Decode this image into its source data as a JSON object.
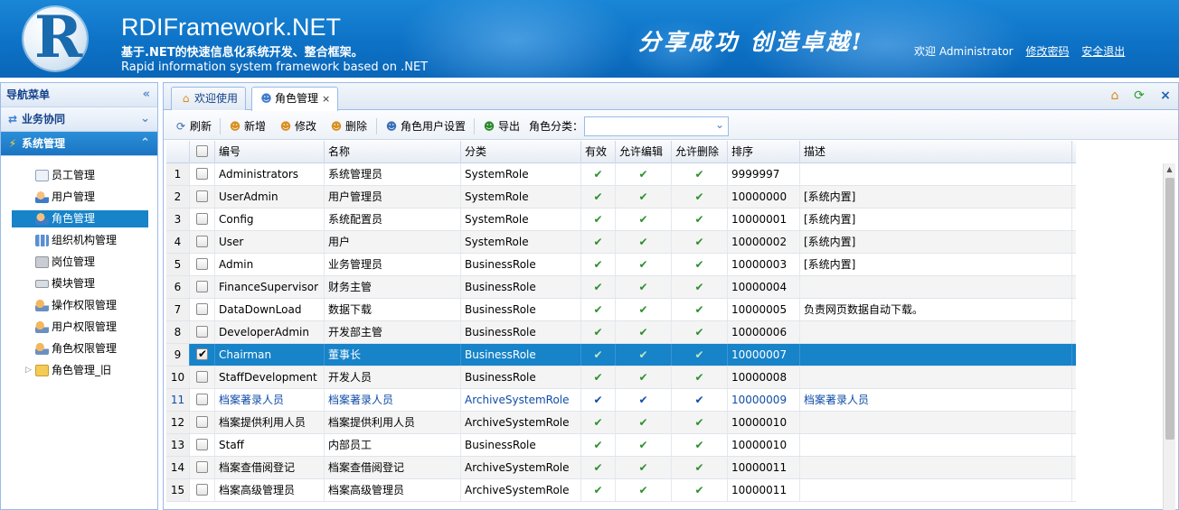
{
  "header": {
    "logo_letter": "R",
    "title": "RDIFramework.NET",
    "subtitle_cn": "基于.NET的快速信息化系统开发、整合框架。",
    "subtitle_en": "Rapid information system framework based on .NET",
    "slogan": "分享成功  创造卓越!",
    "welcome": "欢迎 Administrator",
    "change_password": "修改密码",
    "logout": "安全退出"
  },
  "sidebar": {
    "title": "导航菜单",
    "sections": [
      {
        "label": "业务协同",
        "icon": "swap-icon"
      },
      {
        "label": "系统管理",
        "icon": "lightning-icon"
      }
    ],
    "items": [
      {
        "label": "员工管理",
        "icon": "id-card-icon"
      },
      {
        "label": "用户管理",
        "icon": "user-icon"
      },
      {
        "label": "角色管理",
        "icon": "role-icon",
        "selected": true
      },
      {
        "label": "组织机构管理",
        "icon": "org-chart-icon"
      },
      {
        "label": "岗位管理",
        "icon": "box-icon"
      },
      {
        "label": "模块管理",
        "icon": "keyboard-icon"
      },
      {
        "label": "操作权限管理",
        "icon": "permission-icon"
      },
      {
        "label": "用户权限管理",
        "icon": "user-permission-icon"
      },
      {
        "label": "角色权限管理",
        "icon": "role-permission-icon"
      },
      {
        "label": "角色管理_旧",
        "icon": "folder-icon"
      }
    ]
  },
  "tabs": [
    {
      "label": "欢迎使用",
      "icon": "home-icon"
    },
    {
      "label": "角色管理",
      "icon": "role-icon",
      "active": true,
      "close": "×"
    }
  ],
  "tab_tools": {
    "home": "⌂",
    "refresh": "⟳",
    "close": "×"
  },
  "toolbar": {
    "refresh": "刷新",
    "add": "新增",
    "edit": "修改",
    "delete": "删除",
    "role_users": "角色用户设置",
    "export": "导出",
    "category_label": "角色分类：",
    "category_value": ""
  },
  "grid": {
    "columns": [
      "编号",
      "名称",
      "分类",
      "有效",
      "允许编辑",
      "允许删除",
      "排序",
      "描述"
    ],
    "check_mark": "✔",
    "rows": [
      {
        "num": "1",
        "code": "Administrators",
        "name": "系统管理员",
        "category": "SystemRole",
        "sort": "9999997",
        "desc": ""
      },
      {
        "num": "2",
        "code": "UserAdmin",
        "name": "用户管理员",
        "category": "SystemRole",
        "sort": "10000000",
        "desc": "[系统内置]"
      },
      {
        "num": "3",
        "code": "Config",
        "name": "系统配置员",
        "category": "SystemRole",
        "sort": "10000001",
        "desc": "[系统内置]"
      },
      {
        "num": "4",
        "code": "User",
        "name": "用户",
        "category": "SystemRole",
        "sort": "10000002",
        "desc": "[系统内置]"
      },
      {
        "num": "5",
        "code": "Admin",
        "name": "业务管理员",
        "category": "BusinessRole",
        "sort": "10000003",
        "desc": "[系统内置]"
      },
      {
        "num": "6",
        "code": "FinanceSupervisor",
        "name": "财务主管",
        "category": "BusinessRole",
        "sort": "10000004",
        "desc": ""
      },
      {
        "num": "7",
        "code": "DataDownLoad",
        "name": "数据下载",
        "category": "BusinessRole",
        "sort": "10000005",
        "desc": "负责网页数据自动下载。"
      },
      {
        "num": "8",
        "code": "DeveloperAdmin",
        "name": "开发部主管",
        "category": "BusinessRole",
        "sort": "10000006",
        "desc": ""
      },
      {
        "num": "9",
        "code": "Chairman",
        "name": "董事长",
        "category": "BusinessRole",
        "sort": "10000007",
        "desc": "",
        "checked": true
      },
      {
        "num": "10",
        "code": "StaffDevelopment",
        "name": "开发人员",
        "category": "BusinessRole",
        "sort": "10000008",
        "desc": ""
      },
      {
        "num": "11",
        "code": "档案著录人员",
        "name": "档案著录人员",
        "category": "ArchiveSystemRole",
        "sort": "10000009",
        "desc": "档案著录人员"
      },
      {
        "num": "12",
        "code": "档案提供利用人员",
        "name": "档案提供利用人员",
        "category": "ArchiveSystemRole",
        "sort": "10000010",
        "desc": ""
      },
      {
        "num": "13",
        "code": "Staff",
        "name": "内部员工",
        "category": "BusinessRole",
        "sort": "10000010",
        "desc": ""
      },
      {
        "num": "14",
        "code": "档案查借阅登记",
        "name": "档案查借阅登记",
        "category": "ArchiveSystemRole",
        "sort": "10000011",
        "desc": ""
      },
      {
        "num": "15",
        "code": "档案高级管理员",
        "name": "档案高级管理员",
        "category": "ArchiveSystemRole",
        "sort": "10000011",
        "desc": ""
      }
    ]
  }
}
